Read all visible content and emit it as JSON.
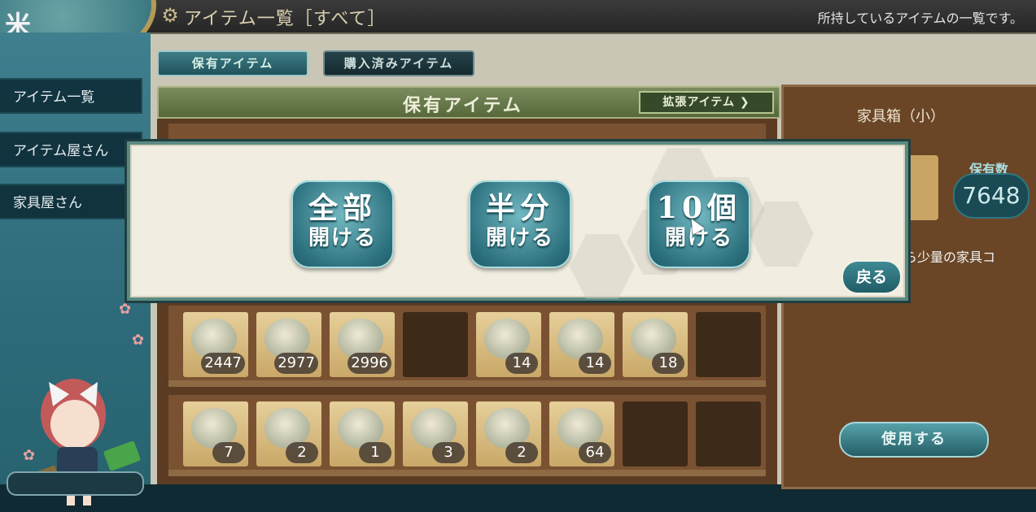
{
  "topbar": {
    "title": "アイテム一覧［すべて］",
    "subtitle": "所持しているアイテムの一覧です。",
    "emblem_glyph": "米"
  },
  "sidebar": {
    "items": [
      {
        "label": "アイテム一覧"
      },
      {
        "label": "アイテム屋さん"
      },
      {
        "label": "家具屋さん"
      }
    ]
  },
  "tabs": [
    {
      "label": "保有アイテム"
    },
    {
      "label": "購入済みアイテム"
    }
  ],
  "shelf": {
    "header": "保有アイテム",
    "expand_button": "拡張アイテム ❯"
  },
  "rows": [
    {
      "slots": [
        {
          "count": "2447"
        },
        {
          "count": "2977"
        },
        {
          "count": "2996"
        },
        {
          "count": ""
        },
        {
          "count": "14"
        },
        {
          "count": "14"
        },
        {
          "count": "18"
        },
        {
          "count": ""
        }
      ]
    },
    {
      "slots": [
        {
          "count": "7"
        },
        {
          "count": "2"
        },
        {
          "count": "1"
        },
        {
          "count": "3"
        },
        {
          "count": "2"
        },
        {
          "count": "64"
        },
        {
          "count": ""
        },
        {
          "count": ""
        }
      ]
    }
  ],
  "detail": {
    "item_name": "家具箱（小）",
    "have_label": "保有数",
    "have_count": "7648",
    "desc_line1": "ら少量の家具コ",
    "desc_line2": "。",
    "use_button": "使用する"
  },
  "dialog": {
    "options": [
      {
        "line1": "全部",
        "line2": "開ける"
      },
      {
        "line1": "半分",
        "line2": "開ける"
      },
      {
        "line1": "10個",
        "line2": "開ける"
      }
    ],
    "back_button": "戻る"
  }
}
